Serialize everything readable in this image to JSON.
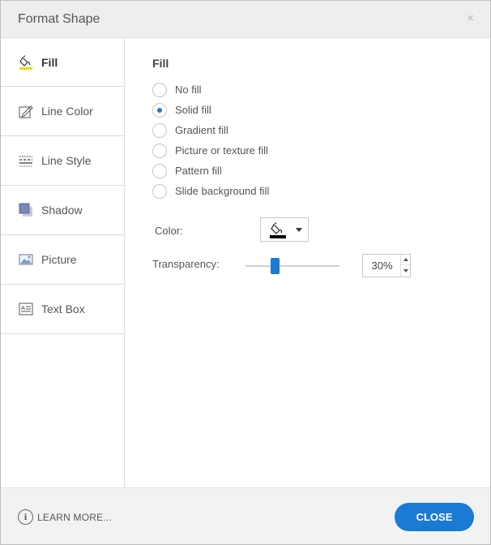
{
  "window": {
    "title": "Format Shape",
    "close_glyph": "×"
  },
  "sidebar": {
    "items": [
      {
        "label": "Fill",
        "icon": "paint-bucket-icon",
        "active": true
      },
      {
        "label": "Line Color",
        "icon": "pencil-icon",
        "active": false
      },
      {
        "label": "Line Style",
        "icon": "line-style-icon",
        "active": false
      },
      {
        "label": "Shadow",
        "icon": "shadow-icon",
        "active": false
      },
      {
        "label": "Picture",
        "icon": "picture-icon",
        "active": false
      },
      {
        "label": "Text Box",
        "icon": "text-box-icon",
        "active": false
      }
    ]
  },
  "fill": {
    "section_title": "Fill",
    "options": [
      {
        "label": "No fill",
        "checked": false
      },
      {
        "label": "Solid fill",
        "checked": true
      },
      {
        "label": "Gradient fill",
        "checked": false
      },
      {
        "label": "Picture or texture fill",
        "checked": false
      },
      {
        "label": "Pattern fill",
        "checked": false
      },
      {
        "label": "Slide background fill",
        "checked": false
      }
    ],
    "color_label": "Color:",
    "color_value": "#000000",
    "transparency_label": "Transparency:",
    "transparency_value": "30%",
    "transparency_fraction": 0.3
  },
  "footer": {
    "learn_more": "LEARN MORE...",
    "close_label": "CLOSE"
  },
  "colors": {
    "accent": "#1a7ad4",
    "title_bar": "#eeeeee",
    "footer_bg": "#f2f2f2",
    "fill_icon_yellow": "#f5d90a"
  }
}
